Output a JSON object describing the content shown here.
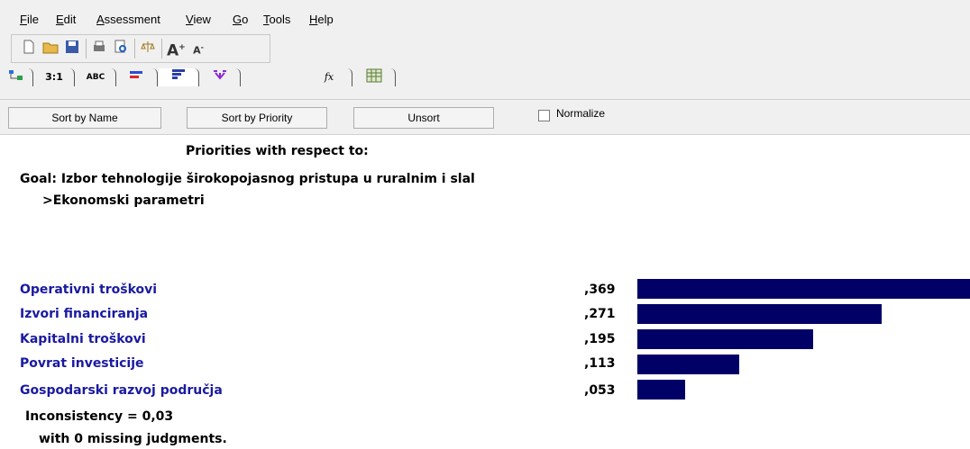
{
  "menu": {
    "items": [
      "File",
      "Edit",
      "Assessment",
      "View",
      "Go",
      "Tools",
      "Help"
    ]
  },
  "tabs": {
    "labels": [
      "",
      "3:1",
      "ABC",
      "",
      "",
      "",
      "fx",
      ""
    ]
  },
  "sortbar": {
    "sort_by_name": "Sort by Name",
    "sort_by_priority": "Sort by Priority",
    "unsort": "Unsort",
    "normalize": "Normalize"
  },
  "header": {
    "priorities_title": "Priorities with respect to:",
    "goal": "Goal: Izbor tehnologije širokopojasnog pristupa u ruralnim i slal",
    "node": ">Ekonomski parametri"
  },
  "chart_data": {
    "type": "bar",
    "categories": [
      "Operativni troškovi",
      "Izvori financiranja",
      "Kapitalni troškovi",
      "Povrat investicije",
      "Gospodarski razvoj područja"
    ],
    "values": [
      0.369,
      0.271,
      0.195,
      0.113,
      0.053
    ],
    "value_labels": [
      ",369",
      ",271",
      ",195",
      ",113",
      ",053"
    ],
    "bar_color": "#000066"
  },
  "footer": {
    "inconsistency": "Inconsistency = 0,03",
    "missing": "with 0  missing judgments."
  }
}
